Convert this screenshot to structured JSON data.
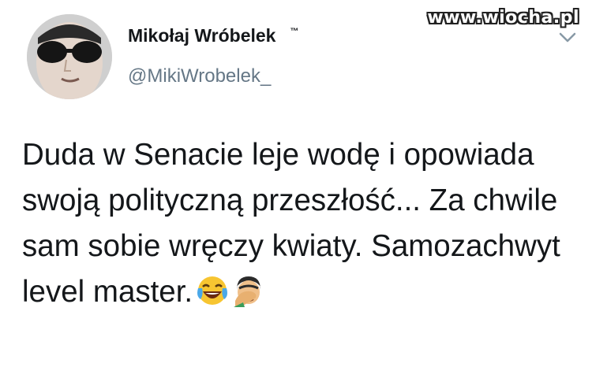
{
  "watermark": "www.wiocha.pl",
  "tweet": {
    "author_name": "Mikołaj Wróbelek",
    "author_badge": "™",
    "handle": "@MikiWrobelek_",
    "text": "Duda w Senacie leje wodę i opowiada swoją polityczną przeszłość... Za chwile sam sobie wręczy kwiaty. Samozachwyt level master.",
    "emojis": [
      "face-with-tears-of-joy-icon",
      "man-facepalming-icon"
    ]
  },
  "icons": {
    "menu": "chevron-down-icon"
  }
}
